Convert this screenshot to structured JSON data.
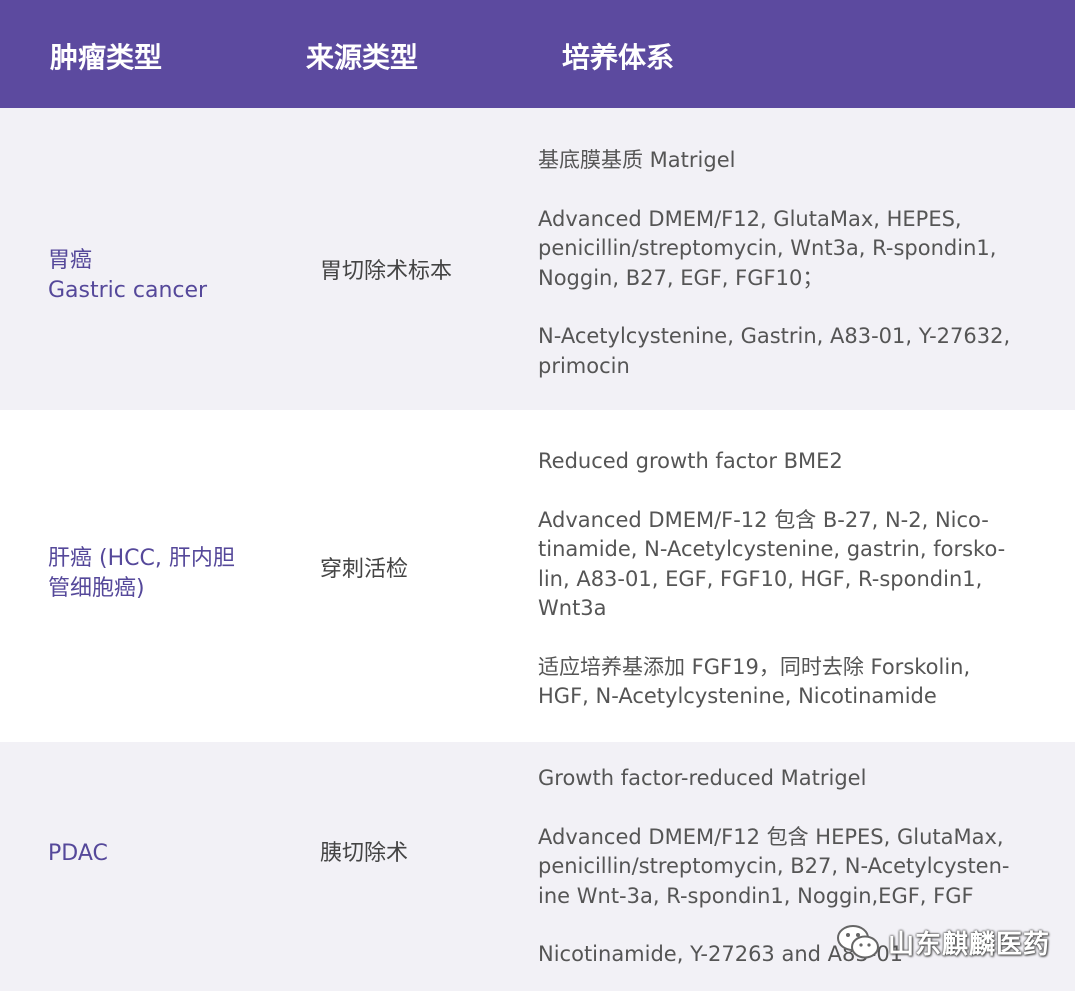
{
  "header": {
    "col_type": "肿瘤类型",
    "col_source": "来源类型",
    "col_culture": "培养体系"
  },
  "rows": [
    {
      "type_lines": [
        "胃癌",
        "Gastric cancer"
      ],
      "source": "胃切除术标本",
      "culture": [
        [
          "基底膜基质 Matrigel"
        ],
        [
          "Advanced DMEM/F12, GlutaMax, HEPES,",
          "penicillin/streptomycin, Wnt3a, R-spondin1,",
          "Noggin, B27, EGF, FGF10；"
        ],
        [
          "N-Acetylcystenine, Gastrin, A83-01, Y-27632,",
          "primocin"
        ]
      ]
    },
    {
      "type_lines": [
        "肝癌 (HCC, 肝内胆",
        "管细胞癌)"
      ],
      "source": "穿刺活检",
      "culture": [
        [
          "Reduced growth factor BME2"
        ],
        [
          "Advanced DMEM/F-12 包含 B-27, N-2, Nico-",
          "tinamide, N-Acetylcystenine, gastrin, forsko-",
          "lin, A83-01, EGF, FGF10, HGF, R-spondin1,",
          "Wnt3a"
        ],
        [
          "适应培养基添加 FGF19，同时去除 Forskolin,",
          "HGF, N-Acetylcystenine, Nicotinamide"
        ]
      ]
    },
    {
      "type_lines": [
        "PDAC"
      ],
      "source": "胰切除术",
      "culture": [
        [
          "Growth factor-reduced Matrigel"
        ],
        [
          "Advanced DMEM/F12 包含 HEPES, GlutaMax,",
          "penicillin/streptomycin, B27, N-Acetylcysten-",
          "ine Wnt-3a, R-spondin1, Noggin,EGF, FGF"
        ],
        [
          "Nicotinamide, Y-27263 and A83-01"
        ]
      ]
    }
  ],
  "watermark": {
    "icon": "wechat-icon",
    "text": "山东麒麟医药"
  }
}
